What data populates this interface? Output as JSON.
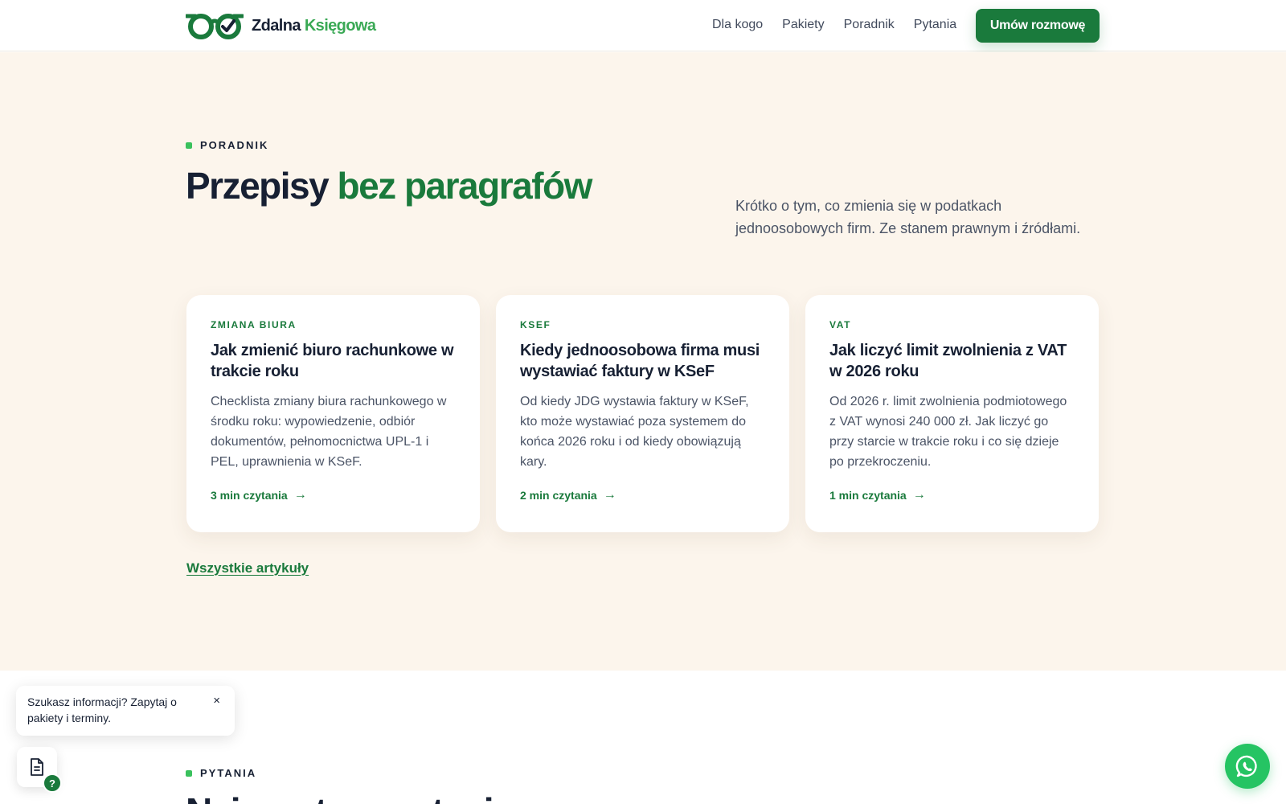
{
  "brand": {
    "name_part1": "Zdalna",
    "name_part2": "Księgowa",
    "logo_icon": "eyeglasses-check-logo"
  },
  "nav": {
    "items": [
      {
        "label": "Dla kogo"
      },
      {
        "label": "Pakiety"
      },
      {
        "label": "Poradnik"
      },
      {
        "label": "Pytania"
      }
    ],
    "cta_label": "Umów rozmowę"
  },
  "poradnik": {
    "eyebrow": "PORADNIK",
    "headline_part1": "Przepisy",
    "headline_part2": "bez paragrafów",
    "lede": "Krótko o tym, co zmienia się w podatkach jednoosobowych firm. Ze stanem prawnym i źródłami.",
    "cards": [
      {
        "tag": "ZMIANA BIURA",
        "title": "Jak zmienić biuro rachunkowe w trakcie roku",
        "excerpt": "Checklista zmiany biura rachunkowego w środku roku: wypowiedzenie, odbiór dokumentów, pełnomocnictwa UPL-1 i PEL, uprawnienia w KSeF.",
        "readtime": "3 min czytania"
      },
      {
        "tag": "KSEF",
        "title": "Kiedy jednoosobowa firma musi wystawiać faktury w KSeF",
        "excerpt": "Od kiedy JDG wystawia faktury w KSeF, kto może wystawiać poza systemem do końca 2026 roku i od kiedy obowiązują kary.",
        "readtime": "2 min czytania"
      },
      {
        "tag": "VAT",
        "title": "Jak liczyć limit zwolnienia z VAT w 2026 roku",
        "excerpt": "Od 2026 r. limit zwolnienia podmiotowego z VAT wynosi 240 000 zł. Jak liczyć go przy starcie w trakcie roku i co się dzieje po przekroczeniu.",
        "readtime": "1 min czytania"
      }
    ],
    "all_articles_label": "Wszystkie artykuły"
  },
  "pytania": {
    "eyebrow": "PYTANIA",
    "headline_partial": "Najczęstsze pytania"
  },
  "chat": {
    "message": "Szukasz informacji? Zapytaj o pakiety i terminy.",
    "close_label": "×",
    "help_badge": "?"
  },
  "colors": {
    "brand_green": "#1a7a3c",
    "accent_green": "#3ac15d",
    "whatsapp_green": "#25c463",
    "section_bg": "#fcf5ec"
  }
}
